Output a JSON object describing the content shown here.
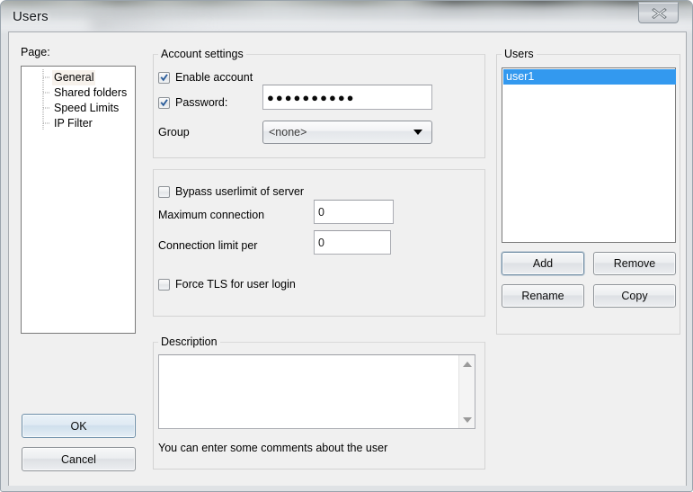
{
  "window": {
    "title": "Users",
    "close_icon": "close-x-icon"
  },
  "page_panel": {
    "label": "Page:",
    "items": [
      {
        "label": "General",
        "selected": true
      },
      {
        "label": "Shared folders",
        "selected": false
      },
      {
        "label": "Speed Limits",
        "selected": false
      },
      {
        "label": "IP Filter",
        "selected": false
      }
    ]
  },
  "account_settings": {
    "legend": "Account settings",
    "enable_account": {
      "label": "Enable account",
      "checked": true
    },
    "password": {
      "label": "Password:",
      "checked": true,
      "value": "●●●●●●●●●●"
    },
    "group": {
      "label": "Group",
      "value": "<none>",
      "arrow_icon": "chevron-down-icon"
    }
  },
  "limits": {
    "bypass_userlimit": {
      "label": "Bypass userlimit of server",
      "checked": false
    },
    "maximum_connection": {
      "label": "Maximum connection",
      "value": "0"
    },
    "connection_limit_per": {
      "label": "Connection limit per",
      "value": "0"
    },
    "force_tls": {
      "label": "Force TLS for user login",
      "checked": false
    }
  },
  "description": {
    "legend": "Description",
    "value": "",
    "hint": "You can enter some comments about the user",
    "scroll_up_icon": "triangle-up-icon",
    "scroll_down_icon": "triangle-down-icon"
  },
  "users_panel": {
    "legend": "Users",
    "items": [
      {
        "label": "user1",
        "selected": true
      }
    ],
    "buttons": {
      "add": "Add",
      "remove": "Remove",
      "rename": "Rename",
      "copy": "Copy"
    }
  },
  "dialog_buttons": {
    "ok": "OK",
    "cancel": "Cancel"
  },
  "colors": {
    "selection_blue": "#3399ef",
    "checkmark_blue": "#2b5d9b",
    "dialog_bg": "#f0f0f0",
    "default_button_border": "#6d8ea8"
  }
}
